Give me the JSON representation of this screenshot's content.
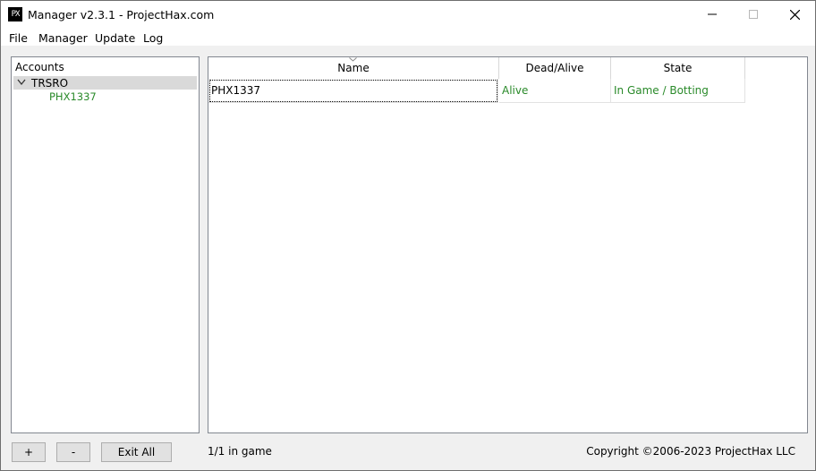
{
  "window": {
    "icon_text": "PX",
    "title": "Manager v2.3.1 - ProjectHax.com"
  },
  "titlebar_controls": [
    "minimize-icon",
    "maximize-icon",
    "close-icon"
  ],
  "menu": {
    "items": [
      "File",
      "Manager",
      "Update",
      "Log"
    ]
  },
  "accounts": {
    "title": "Accounts",
    "group": "TRSRO",
    "child": "PHX1337",
    "child_color": "#2a8a2a"
  },
  "grid": {
    "columns": [
      "Name",
      "Dead/Alive",
      "State"
    ],
    "rows": [
      {
        "name": "PHX1337",
        "dead_alive": "Alive",
        "state": "In Game / Botting"
      }
    ],
    "status_color": "#2a8a2a"
  },
  "footer": {
    "add_label": "+",
    "remove_label": "-",
    "exit_all_label": "Exit All",
    "status_text": "1/1 in game",
    "copyright": "Copyright ©2006-2023 ProjectHax LLC"
  }
}
